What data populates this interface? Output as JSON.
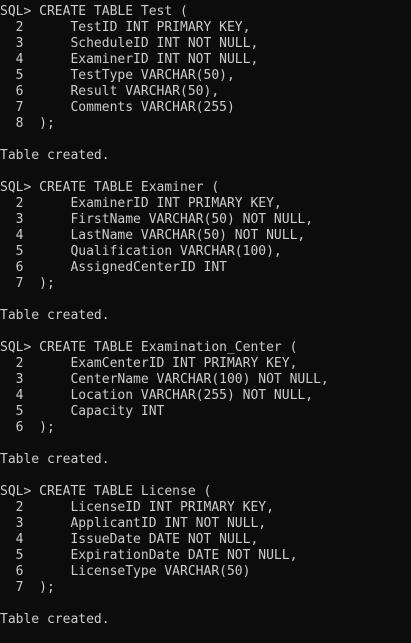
{
  "terminal": {
    "text_color": "#cccccc",
    "background_color": "#0c0c0c",
    "blocks": [
      {
        "lines": [
          "SQL> CREATE TABLE Test (",
          "  2      TestID INT PRIMARY KEY,",
          "  3      ScheduleID INT NOT NULL,",
          "  4      ExaminerID INT NOT NULL,",
          "  5      TestType VARCHAR(50),",
          "  6      Result VARCHAR(50),",
          "  7      Comments VARCHAR(255)",
          "  8  );"
        ],
        "result": "Table created."
      },
      {
        "lines": [
          "SQL> CREATE TABLE Examiner (",
          "  2      ExaminerID INT PRIMARY KEY,",
          "  3      FirstName VARCHAR(50) NOT NULL,",
          "  4      LastName VARCHAR(50) NOT NULL,",
          "  5      Qualification VARCHAR(100),",
          "  6      AssignedCenterID INT",
          "  7  );"
        ],
        "result": "Table created."
      },
      {
        "lines": [
          "SQL> CREATE TABLE Examination_Center (",
          "  2      ExamCenterID INT PRIMARY KEY,",
          "  3      CenterName VARCHAR(100) NOT NULL,",
          "  4      Location VARCHAR(255) NOT NULL,",
          "  5      Capacity INT",
          "  6  );"
        ],
        "result": "Table created."
      },
      {
        "lines": [
          "SQL> CREATE TABLE License (",
          "  2      LicenseID INT PRIMARY KEY,",
          "  3      ApplicantID INT NOT NULL,",
          "  4      IssueDate DATE NOT NULL,",
          "  5      ExpirationDate DATE NOT NULL,",
          "  6      LicenseType VARCHAR(50)",
          "  7  );"
        ],
        "result": "Table created."
      }
    ]
  }
}
